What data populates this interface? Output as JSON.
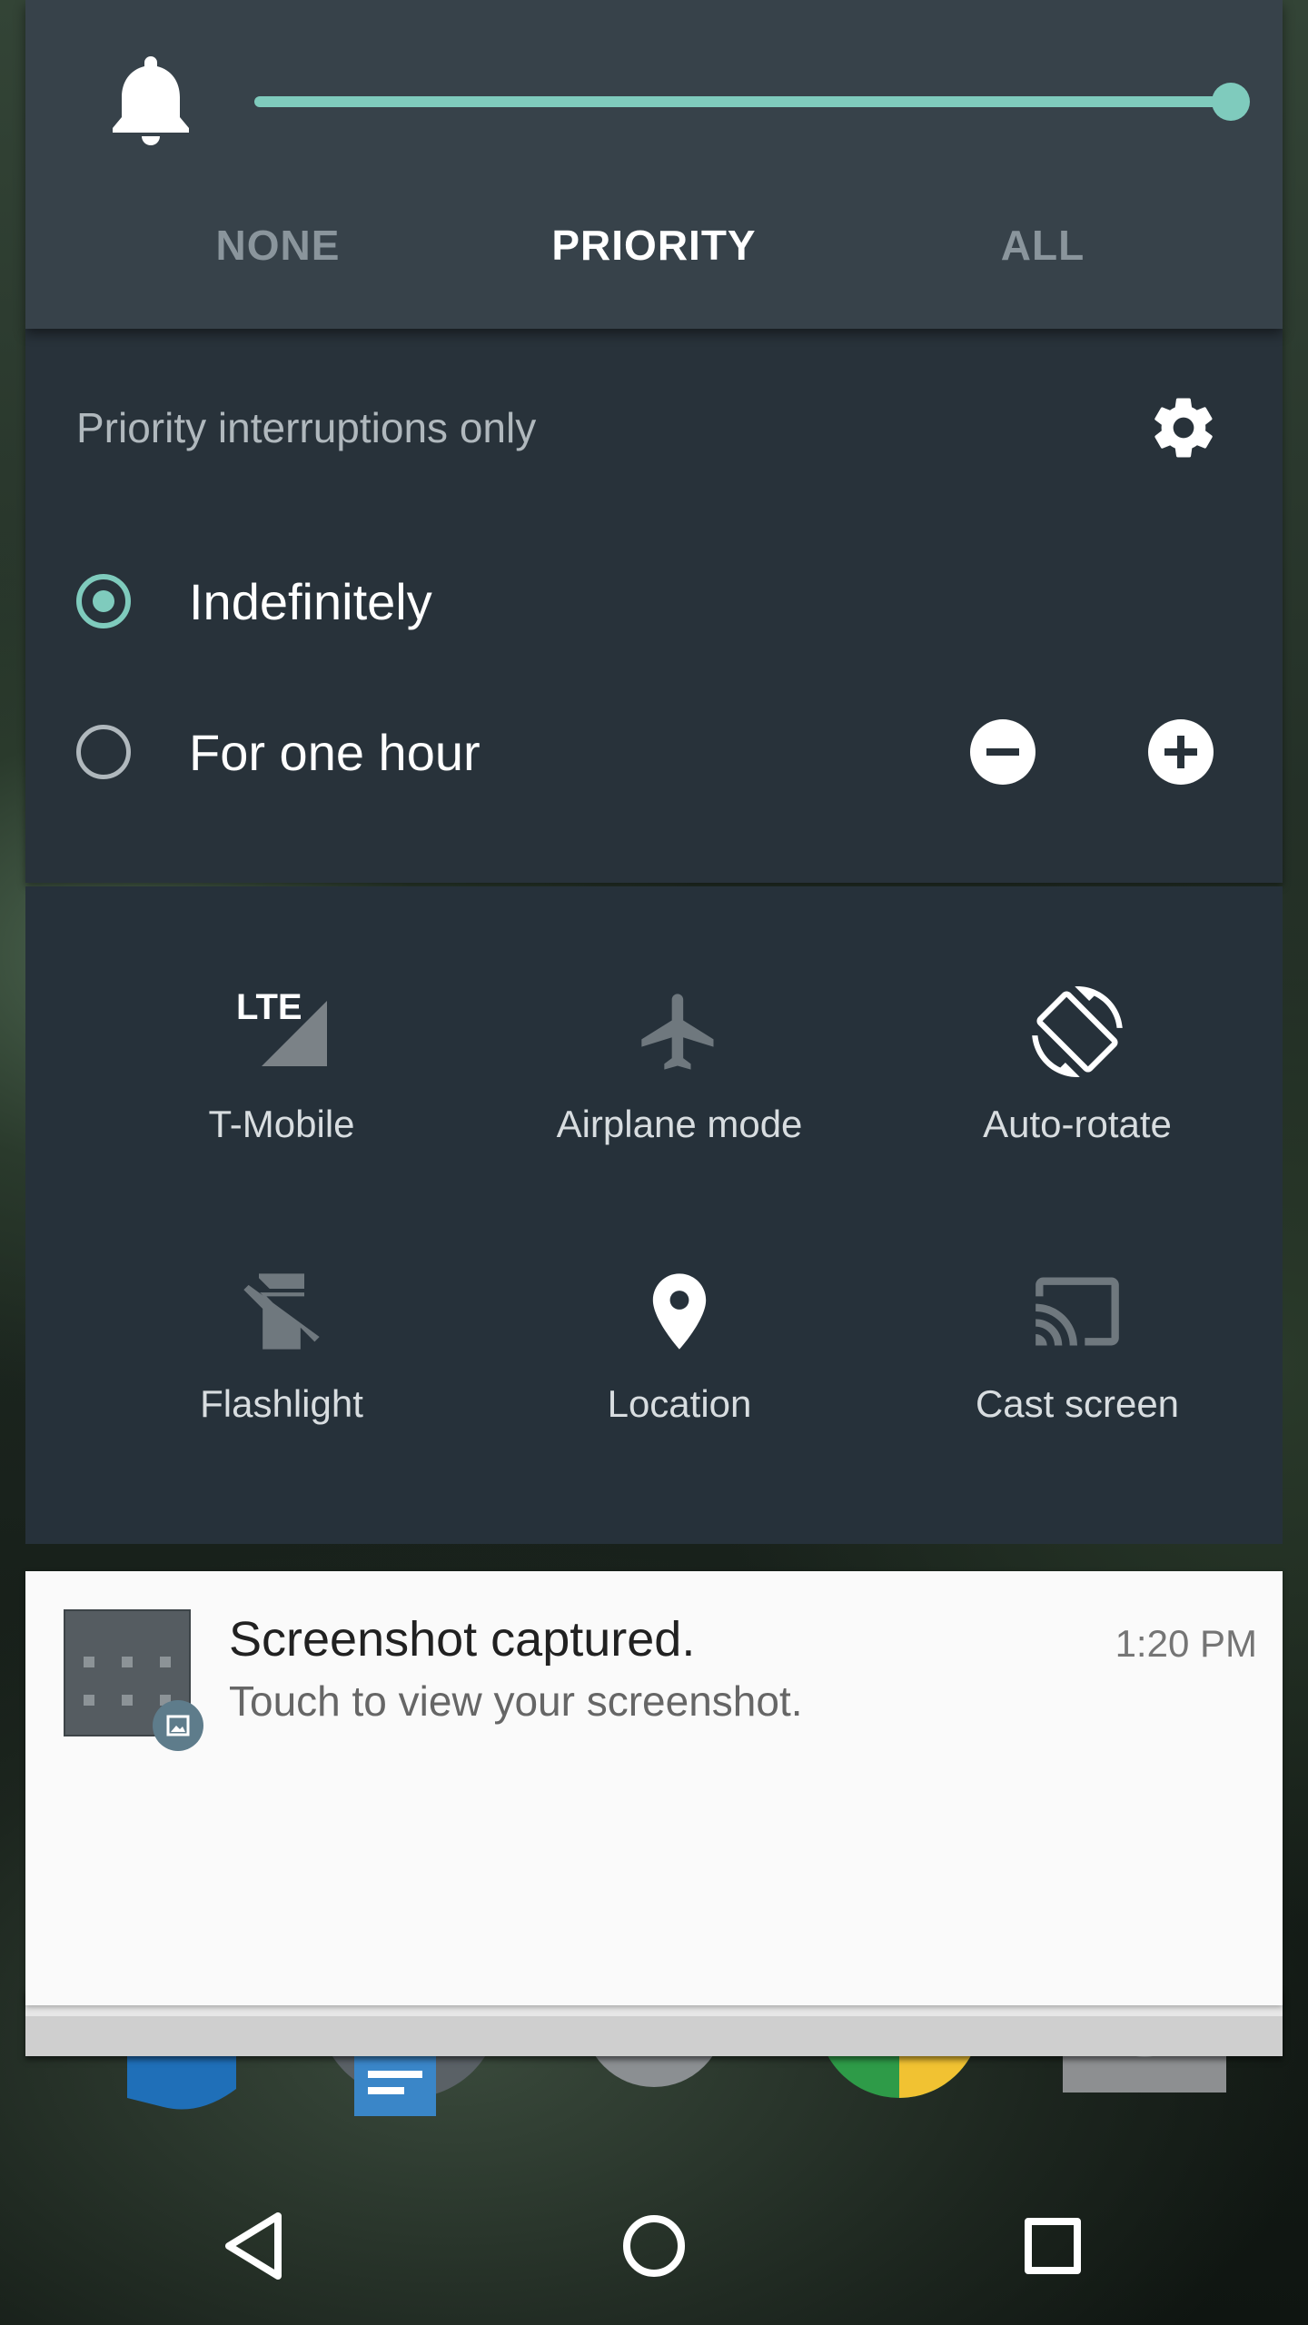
{
  "volume": {
    "icon": "bell-icon",
    "level": 1.0,
    "accent_color": "#7fcbbd"
  },
  "interruption_modes": [
    {
      "label": "NONE",
      "selected": false
    },
    {
      "label": "PRIORITY",
      "selected": true
    },
    {
      "label": "ALL",
      "selected": false
    }
  ],
  "priority": {
    "title": "Priority interruptions only",
    "settings_icon": "gear-icon",
    "options": [
      {
        "label": "Indefinitely",
        "checked": true
      },
      {
        "label": "For one hour",
        "checked": false
      }
    ],
    "decrease_icon": "minus-circle-icon",
    "increase_icon": "plus-circle-icon"
  },
  "quick_settings": [
    {
      "label": "T-Mobile",
      "icon": "lte-signal-icon",
      "badge": "LTE",
      "active": true
    },
    {
      "label": "Airplane mode",
      "icon": "airplane-icon",
      "active": false
    },
    {
      "label": "Auto-rotate",
      "icon": "auto-rotate-icon",
      "active": true
    },
    {
      "label": "Flashlight",
      "icon": "flashlight-off-icon",
      "active": false
    },
    {
      "label": "Location",
      "icon": "location-pin-icon",
      "active": true
    },
    {
      "label": "Cast screen",
      "icon": "cast-icon",
      "active": false
    }
  ],
  "notification": {
    "title": "Screenshot captured.",
    "text": "Touch to view your screenshot.",
    "time": "1:20 PM",
    "thumb_icon": "image-icon"
  },
  "navbar": {
    "back_icon": "back-triangle-icon",
    "home_icon": "home-circle-icon",
    "recents_icon": "recents-square-icon"
  }
}
